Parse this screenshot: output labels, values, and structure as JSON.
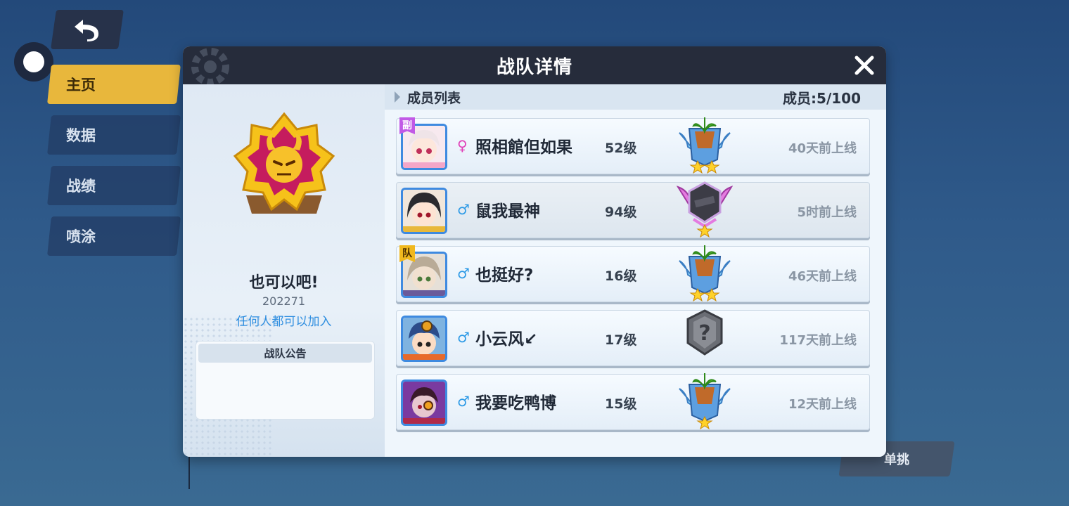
{
  "side_menu": {
    "items": [
      {
        "label": "主页",
        "active": true
      },
      {
        "label": "数据",
        "active": false
      },
      {
        "label": "战绩",
        "active": false
      },
      {
        "label": "喷涂",
        "active": false
      }
    ]
  },
  "background_button": {
    "label": "单挑"
  },
  "modal": {
    "title": "战队详情",
    "team": {
      "name": "也可以吧!",
      "id": "202271",
      "join_policy": "任何人都可以加入",
      "notice_title": "战队公告",
      "notice_text": ""
    },
    "members_header": {
      "title": "成员列表",
      "count": "成员:5/100"
    },
    "members": [
      {
        "name": "照相館但如果",
        "gender": "♀",
        "level": "52级",
        "last_online": "40天前上线",
        "role_tag": "副",
        "rank_icon": "pot-plant-silver-wings-icon",
        "stars": 2
      },
      {
        "name": "鼠我最神",
        "gender": "♂",
        "level": "94级",
        "last_online": "5时前上线",
        "role_tag": "",
        "rank_icon": "dark-gem-pink-wings-icon",
        "stars": 1
      },
      {
        "name": "也挺好?",
        "gender": "♂",
        "level": "16级",
        "last_online": "46天前上线",
        "role_tag": "队",
        "rank_icon": "pot-plant-silver-wings-icon",
        "stars": 2
      },
      {
        "name": "小云风↙",
        "gender": "♂",
        "level": "17级",
        "last_online": "117天前上线",
        "role_tag": "",
        "rank_icon": "unknown-rank-shield-icon",
        "stars": 0
      },
      {
        "name": "我要吃鸭博",
        "gender": "♂",
        "level": "15级",
        "last_online": "12天前上线",
        "role_tag": "",
        "rank_icon": "pot-plant-silver-wings-icon",
        "stars": 1
      }
    ]
  },
  "colors": {
    "accent_yellow": "#e8b73c",
    "header_dark": "#262c3b",
    "link_blue": "#2f8ee0",
    "female_pink": "#e040b8",
    "male_blue": "#2d9ae6"
  }
}
